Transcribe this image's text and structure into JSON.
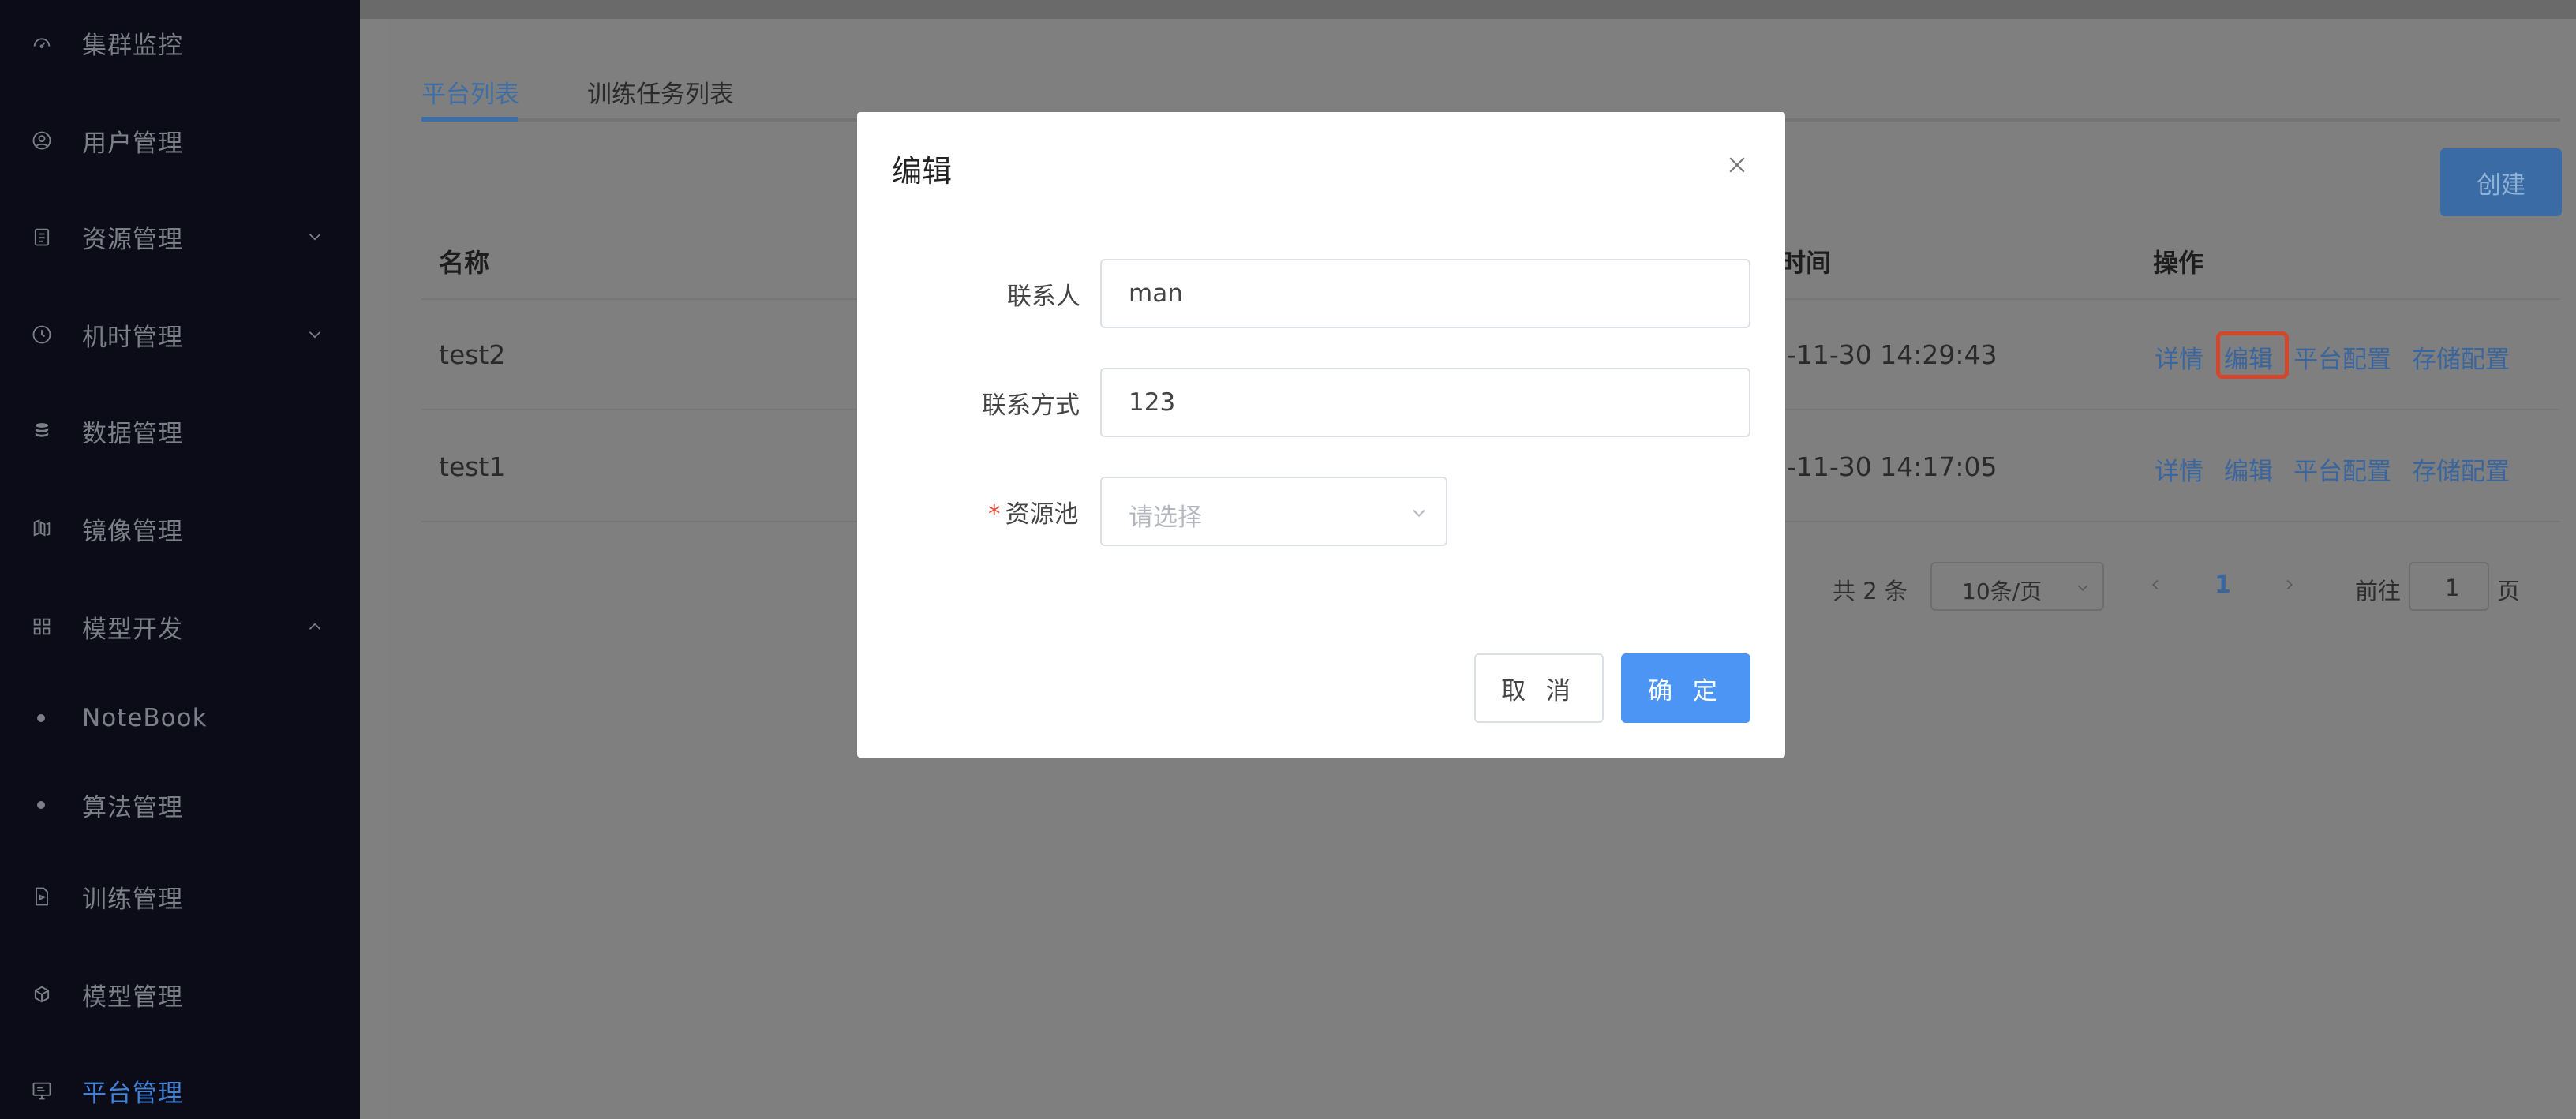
{
  "sidebar": {
    "items": [
      {
        "label": "集群监控",
        "icon": "dashboard-icon"
      },
      {
        "label": "用户管理",
        "icon": "user-icon"
      },
      {
        "label": "资源管理",
        "icon": "clipboard-icon",
        "expandable": true
      },
      {
        "label": "机时管理",
        "icon": "clock-icon",
        "expandable": true
      },
      {
        "label": "数据管理",
        "icon": "database-icon"
      },
      {
        "label": "镜像管理",
        "icon": "image-icon"
      },
      {
        "label": "模型开发",
        "icon": "grid-icon",
        "expanded": true
      },
      {
        "label": "NoteBook",
        "sub": true
      },
      {
        "label": "算法管理",
        "sub": true
      },
      {
        "label": "训练管理",
        "icon": "document-icon"
      },
      {
        "label": "模型管理",
        "icon": "cube-icon"
      },
      {
        "label": "平台管理",
        "icon": "monitor-icon",
        "active": true
      }
    ]
  },
  "tabs": [
    {
      "label": "平台列表",
      "active": true
    },
    {
      "label": "训练任务列表",
      "active": false
    }
  ],
  "toolbar": {
    "create_label": "创建"
  },
  "table": {
    "headers": {
      "name": "名称",
      "time": "时间",
      "ops": "操作"
    },
    "rows": [
      {
        "name": "test2",
        "time": "-11-30 14:29:43"
      },
      {
        "name": "test1",
        "time": "-11-30 14:17:05"
      }
    ],
    "ops": {
      "detail": "详情",
      "edit": "编辑",
      "platform_config": "平台配置",
      "storage_config": "存储配置"
    }
  },
  "pagination": {
    "total": "共 2 条",
    "page_size": "10条/页",
    "current": "1",
    "goto_prefix": "前往",
    "goto_value": "1",
    "goto_suffix": "页"
  },
  "modal": {
    "title": "编辑",
    "contact_label": "联系人",
    "contact_value": "man",
    "phone_label": "联系方式",
    "phone_value": "123",
    "pool_label": "资源池",
    "pool_required": "*",
    "pool_placeholder": "请选择",
    "cancel_label": "取 消",
    "ok_label": "确 定"
  },
  "colors": {
    "accent": "#4c95f5",
    "sidebar_bg": "#0b0c17",
    "highlight": "#d2462c",
    "required": "#e04a3a"
  }
}
